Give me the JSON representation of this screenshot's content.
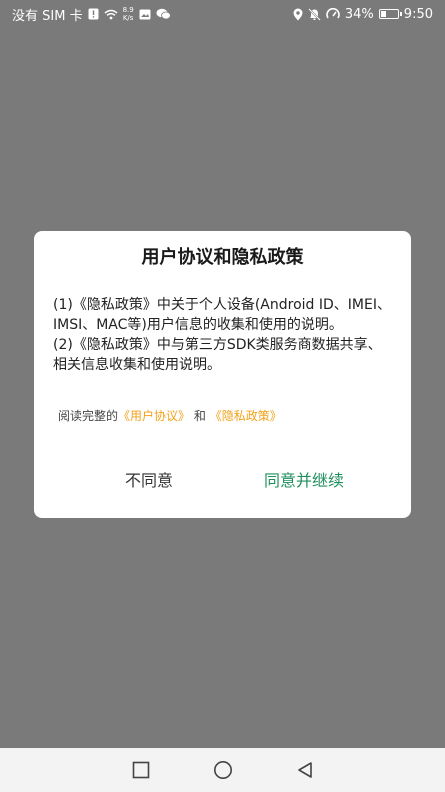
{
  "status_bar": {
    "carrier": "没有 SIM 卡",
    "speed_value": "8.9",
    "speed_unit": "K/s",
    "battery_percent": "34%",
    "battery_level": 0.34,
    "time": "9:50",
    "icons": [
      "sim-alert-icon",
      "wifi-icon",
      "wechat-icon",
      "location-icon",
      "mute-bell-icon",
      "speedometer-icon",
      "battery-icon"
    ]
  },
  "dialog": {
    "title": "用户协议和隐私政策",
    "paragraph1": "(1)《隐私政策》中关于个人设备(Android ID、IMEI、IMSI、MAC等)用户信息的收集和使用的说明。",
    "paragraph2": " (2)《隐私政策》中与第三方SDK类服务商数据共享、相关信息收集和使用说明。",
    "read_prefix": "阅读完整的",
    "user_agreement_link": "《用户协议》",
    "read_and": "和",
    "privacy_policy_link": "《隐私政策》",
    "disagree_label": "不同意",
    "agree_label": "同意并继续",
    "agree_color": "#1f8f5f",
    "link_color": "#f2a21a"
  },
  "nav_bar": {
    "buttons": [
      "recents-square-icon",
      "home-circle-icon",
      "back-triangle-icon"
    ]
  }
}
